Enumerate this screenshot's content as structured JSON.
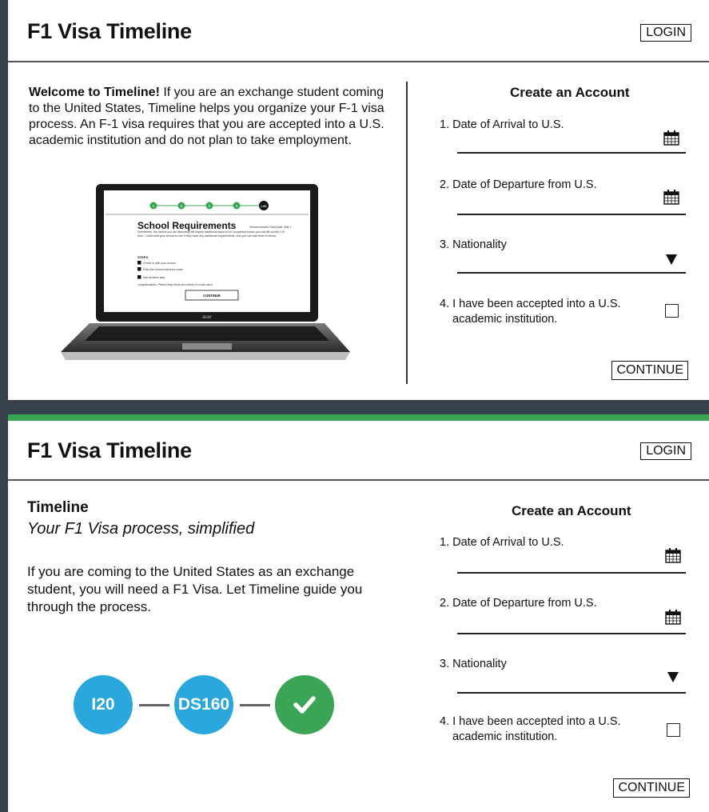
{
  "panel1": {
    "title": "F1 Visa Timeline",
    "login": "LOGIN",
    "intro_bold": "Welcome to Timeline!",
    "intro_text": " If you are an exchange student coming to the United States, Timeline helps you organize your F-1 visa process. An F-1 visa requires that you are accepted into a U.S. academic institution and do not plan to take employment.",
    "form": {
      "title": "Create an Account",
      "arrival": "1. Date of Arrival to U.S.",
      "departure": "2. Date of Departure from U.S.",
      "nationality": "3. Nationality",
      "accepted_line1": "4. I have been accepted into a U.S.",
      "accepted_line2": "academic institution.",
      "continue": "CONTINUE"
    },
    "laptop": {
      "steps": [
        "1",
        "2",
        "3",
        "4",
        "I-20"
      ],
      "heading": "School Requirements",
      "heading_note": "Recommended Start Date: Mar 1",
      "desc": "Sometimes, the school you are attending will require additional steps to be completed before you can fill out the I-20 form. Check with your school to see if they have any additional requirements, and you can add them in below.",
      "steps_label": "STEPS",
      "item1": "Check in with your school",
      "item2": "Pass the school entrance exam",
      "item3": "Add another step",
      "congrats": "Congratulations. Please keep these documents in a safe place.",
      "continue": "CONTINUE",
      "brand": "acer"
    }
  },
  "panel2": {
    "title": "F1 Visa Timeline",
    "login": "LOGIN",
    "heading": "Timeline",
    "subheading": "Your F1 Visa process, simplified",
    "body": "If you are coming to the United States as an exchange student, you will need a F1 Visa. Let Timeline guide you through the process.",
    "flow": [
      "I20",
      "DS160"
    ],
    "form": {
      "title": "Create an Account",
      "arrival": "1. Date of Arrival to U.S.",
      "departure": "2. Date of Departure from U.S.",
      "nationality": "3. Nationality",
      "accepted_line1": "4. I have been accepted into a U.S.",
      "accepted_line2": "academic institution.",
      "continue": "CONTINUE"
    }
  },
  "colors": {
    "background": "#35424c",
    "green_accent": "#3aa655",
    "step_blue": "#2aa7dd",
    "step_green": "#3aa655"
  },
  "icons": [
    "calendar-icon",
    "dropdown-arrow-icon",
    "checkmark-icon"
  ]
}
